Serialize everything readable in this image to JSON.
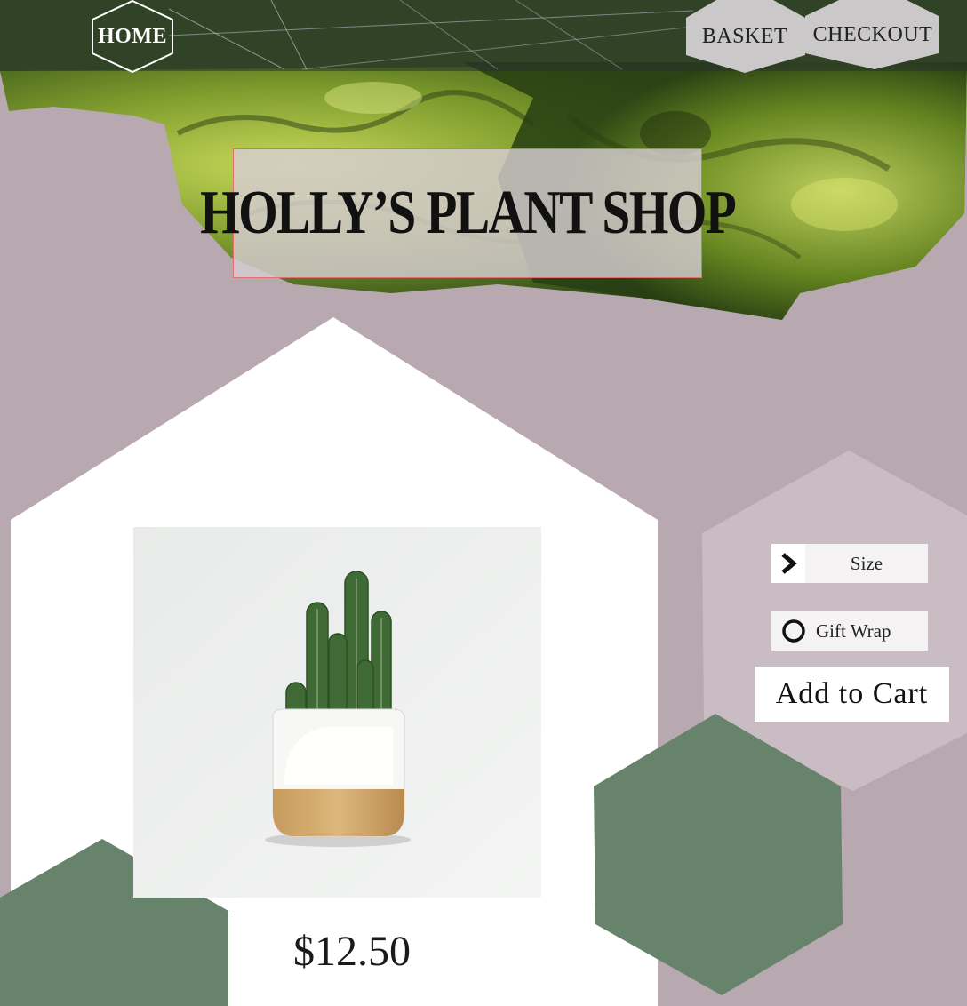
{
  "nav": {
    "home_label": "HOME",
    "basket_label": "BASKET",
    "checkout_label": "CHECKOUT"
  },
  "shop_title": "HOLLY’S PLANT SHOP",
  "product": {
    "price": "$12.50"
  },
  "options": {
    "size_label": "Size",
    "gift_wrap_label": "Gift Wrap",
    "add_to_cart_label": "Add to Cart"
  },
  "colors": {
    "background": "#b8a8b0",
    "hex_white": "#ffffff",
    "hex_green": "#67836b",
    "hex_pale": "#c9bcc2",
    "moss": "#7a9a2a"
  }
}
